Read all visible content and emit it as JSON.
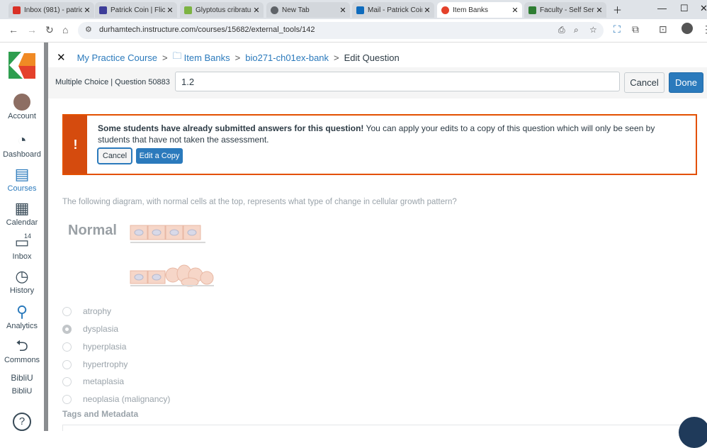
{
  "browser": {
    "tabs": [
      {
        "title": "Inbox (981) - patric",
        "favicon_color": "#d93025"
      },
      {
        "title": "Patrick Coin | Flickr",
        "favicon_color": "#3d3d99"
      },
      {
        "title": "Glyptotus cribratus",
        "favicon_color": "#7cb342"
      },
      {
        "title": "New Tab",
        "favicon_color": "#5f6368"
      },
      {
        "title": "Mail - Patrick Coin",
        "favicon_color": "#0f6cbd"
      },
      {
        "title": "Item Banks",
        "favicon_color": "#e4412b"
      },
      {
        "title": "Faculty - Self Servic",
        "favicon_color": "#2e7d32"
      }
    ],
    "active_tab": 5,
    "url": "durhamtech.instructure.com/courses/15682/external_tools/142"
  },
  "global_nav": {
    "items": [
      {
        "label": "Account",
        "icon": "avatar-icon"
      },
      {
        "label": "Dashboard",
        "icon": "dashboard-icon"
      },
      {
        "label": "Courses",
        "icon": "courses-icon",
        "active": true
      },
      {
        "label": "Calendar",
        "icon": "calendar-icon"
      },
      {
        "label": "Inbox",
        "icon": "inbox-icon",
        "badge": "14"
      },
      {
        "label": "History",
        "icon": "history-icon"
      },
      {
        "label": "Analytics",
        "icon": "analytics-icon"
      },
      {
        "label": "Commons",
        "icon": "commons-icon"
      },
      {
        "label": "BibliU",
        "icon": "bibliu-image",
        "alt": "BibliU"
      },
      {
        "label": "",
        "icon": "help-icon"
      }
    ]
  },
  "breadcrumb": {
    "course": "My Practice Course",
    "item_banks": "Item Banks",
    "bank": "bio271-ch01ex-bank",
    "current": "Edit Question"
  },
  "question_header": {
    "type_label": "Multiple Choice | Question 50883",
    "title_value": "1.2",
    "cancel_label": "Cancel",
    "done_label": "Done"
  },
  "alert": {
    "icon": "!",
    "bold_text": "Some students have already submitted answers for this question!",
    "text": " You can apply your edits to a copy of this question which will only be seen by students that have not taken the assessment.",
    "cancel_label": "Cancel",
    "copy_label": "Edit a Copy"
  },
  "question": {
    "prompt": "The following diagram, with normal cells at the top, represents what type of change in cellular growth pattern?",
    "diagram_label": "Normal",
    "choices": [
      {
        "label": "atrophy",
        "selected": false
      },
      {
        "label": "dysplasia",
        "selected": true
      },
      {
        "label": "hyperplasia",
        "selected": false
      },
      {
        "label": "hypertrophy",
        "selected": false
      },
      {
        "label": "metaplasia",
        "selected": false
      },
      {
        "label": "neoplasia (malignancy)",
        "selected": false
      }
    ]
  },
  "tags_heading": "Tags and Metadata",
  "colors": {
    "accent": "#2b7abc",
    "alert": "#d54b0e"
  }
}
